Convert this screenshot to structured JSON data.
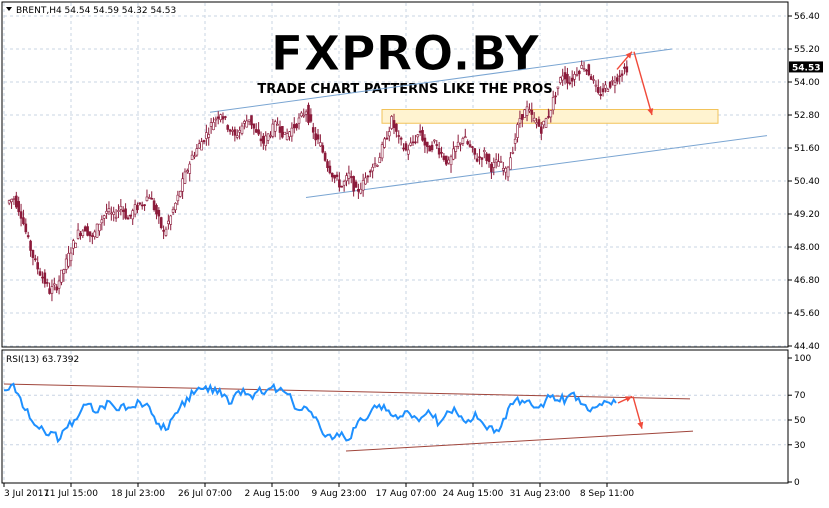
{
  "header": {
    "symbol_line": "BRENT,H4  54.54 54.59 54.32 54.53",
    "rsi_label": "RSI(13) 63.7392"
  },
  "watermark": {
    "logo": "FXPRO.BY",
    "tagline": "TRADE CHART PATTERNS LIKE THE PROS"
  },
  "price_tag": "54.53",
  "colors": {
    "candle": "#8b1a3a",
    "rsi_line": "#1e90ff",
    "channel_line": "#7aa5d2",
    "rsi_trend": "#a0453b",
    "arrow": "#f04a3a",
    "zone_fill": "#fff3d0",
    "zone_border": "#f2c35a",
    "grid": "#c8d4e3",
    "price_tag_bg": "#000000"
  },
  "chart_data": [
    {
      "type": "candlestick",
      "title": "BRENT,H4",
      "ylim": [
        44.4,
        56.4
      ],
      "y_ticks": [
        "56.40",
        "55.20",
        "54.00",
        "52.80",
        "51.60",
        "50.40",
        "49.20",
        "48.00",
        "46.80",
        "45.60",
        "44.40"
      ],
      "x_ticks": [
        "3 Jul 2017",
        "11 Jul 15:00",
        "18 Jul 23:00",
        "26 Jul 07:00",
        "2 Aug 15:00",
        "9 Aug 23:00",
        "17 Aug 07:00",
        "24 Aug 15:00",
        "31 Aug 23:00",
        "8 Sep 11:00"
      ],
      "close_path": [
        49.6,
        49.8,
        49.2,
        48.2,
        47.4,
        46.9,
        46.4,
        46.6,
        47.2,
        47.9,
        48.5,
        48.7,
        48.3,
        48.9,
        49.3,
        49.1,
        49.5,
        49.0,
        49.4,
        49.6,
        49.9,
        49.2,
        48.5,
        49.1,
        49.8,
        50.6,
        51.3,
        51.7,
        52.1,
        52.6,
        52.9,
        52.4,
        52.0,
        52.4,
        52.7,
        52.1,
        51.8,
        52.2,
        52.5,
        52.0,
        52.3,
        52.6,
        53.0,
        52.1,
        51.7,
        51.0,
        50.5,
        50.2,
        50.6,
        50.0,
        50.3,
        50.9,
        51.1,
        51.8,
        52.6,
        51.9,
        51.5,
        51.8,
        52.2,
        51.5,
        51.8,
        51.4,
        51.0,
        51.6,
        52.0,
        51.6,
        51.2,
        51.4,
        50.9,
        51.1,
        50.7,
        51.6,
        52.7,
        53.0,
        52.6,
        52.3,
        52.8,
        53.6,
        54.3,
        54.0,
        54.4,
        54.6,
        54.2,
        53.5,
        53.8,
        54.0,
        54.3,
        54.53
      ],
      "channel": {
        "upper": [
          [
            52.9,
            55.2
          ]
        ],
        "lower": [
          [
            49.8,
            52.05
          ]
        ]
      },
      "zone": [
        53.0,
        52.5
      ],
      "arrow_target": 52.8
    },
    {
      "type": "line",
      "title": "RSI(13) 63.7392",
      "ylim": [
        0,
        100
      ],
      "y_ticks": [
        "100",
        "70",
        "50",
        "30",
        "0"
      ],
      "series": [
        {
          "name": "RSI(13)",
          "values": [
            74,
            78,
            71,
            58,
            49,
            43,
            38,
            40,
            35,
            44,
            50,
            58,
            63,
            56,
            61,
            65,
            58,
            63,
            60,
            66,
            62,
            55,
            47,
            42,
            52,
            60,
            68,
            71,
            75,
            73,
            76,
            69,
            63,
            72,
            75,
            70,
            73,
            71,
            76,
            74,
            72,
            65,
            58,
            60,
            52,
            43,
            38,
            36,
            40,
            34,
            44,
            50,
            55,
            60,
            62,
            54,
            51,
            57,
            52,
            49,
            55,
            52,
            48,
            57,
            60,
            53,
            50,
            56,
            48,
            45,
            42,
            51,
            63,
            68,
            64,
            62,
            60,
            66,
            70,
            65,
            68,
            72,
            63,
            58,
            60,
            62,
            64,
            63.7392
          ]
        }
      ]
    }
  ]
}
